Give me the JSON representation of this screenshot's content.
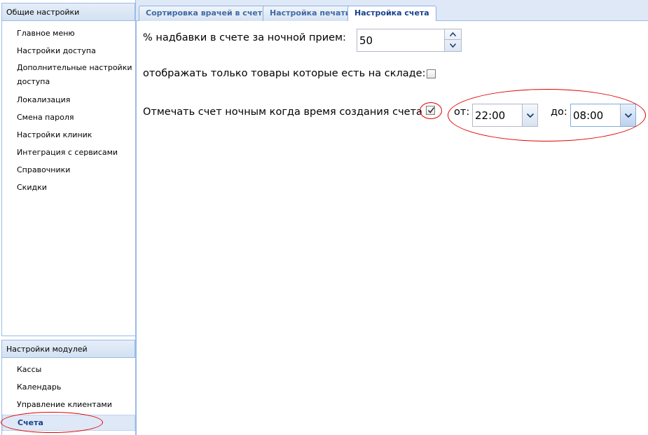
{
  "sidebar": {
    "general_header": "Общие настройки",
    "general_items": [
      {
        "label": "Главное меню"
      },
      {
        "label": "Настройки доступа"
      },
      {
        "label": "Дополнительные настройки доступа"
      },
      {
        "label": "Локализация"
      },
      {
        "label": "Смена пароля"
      },
      {
        "label": "Настройки клиник"
      },
      {
        "label": "Интеграция с сервисами"
      },
      {
        "label": "Справочники"
      },
      {
        "label": "Скидки"
      }
    ],
    "modules_header": "Настройки модулей",
    "modules_items": [
      {
        "label": "Кассы"
      },
      {
        "label": "Календарь"
      },
      {
        "label": "Управление клиентами"
      },
      {
        "label": "Счета",
        "active": true
      }
    ]
  },
  "tabs": [
    {
      "label": "Сортировка врачей в счетах"
    },
    {
      "label": "Настройка печати"
    },
    {
      "label": "Настройка счета",
      "active": true
    }
  ],
  "form": {
    "surcharge_label": "% надбавки в счете за ночной прием:",
    "surcharge_value": "50",
    "stock_only_label": "отображать только товары которые есть на складе:",
    "stock_only_checked": false,
    "night_mark_label": "Отмечать счет ночным когда время создания счета :",
    "night_mark_checked": true,
    "from_label": "от:",
    "from_value": "22:00",
    "to_label": "до:",
    "to_value": "08:00"
  },
  "colors": {
    "accent": "#15428b",
    "panel_border": "#99bbe8",
    "annotation": "#e00000"
  }
}
